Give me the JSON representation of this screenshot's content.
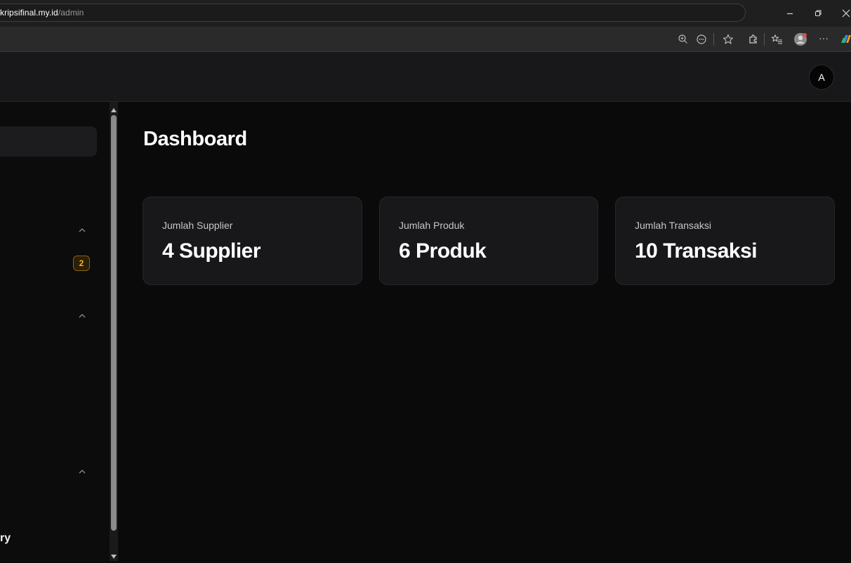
{
  "browser": {
    "url_host": "kripsifinal.my.id",
    "url_path": "/admin",
    "tab_close": "×",
    "new_tab": "+",
    "more_menu": "···"
  },
  "header": {
    "avatar_initial": "A"
  },
  "sidebar": {
    "badge_count": "2",
    "bottom_label": "ry"
  },
  "main": {
    "title": "Dashboard",
    "cards": [
      {
        "label": "Jumlah Supplier",
        "value": "4 Supplier"
      },
      {
        "label": "Jumlah Produk",
        "value": "6 Produk"
      },
      {
        "label": "Jumlah Transaksi",
        "value": "10 Transaksi"
      }
    ]
  },
  "colors": {
    "background": "#0a0a0b",
    "card": "#18181b",
    "badge": "#f5b324"
  }
}
